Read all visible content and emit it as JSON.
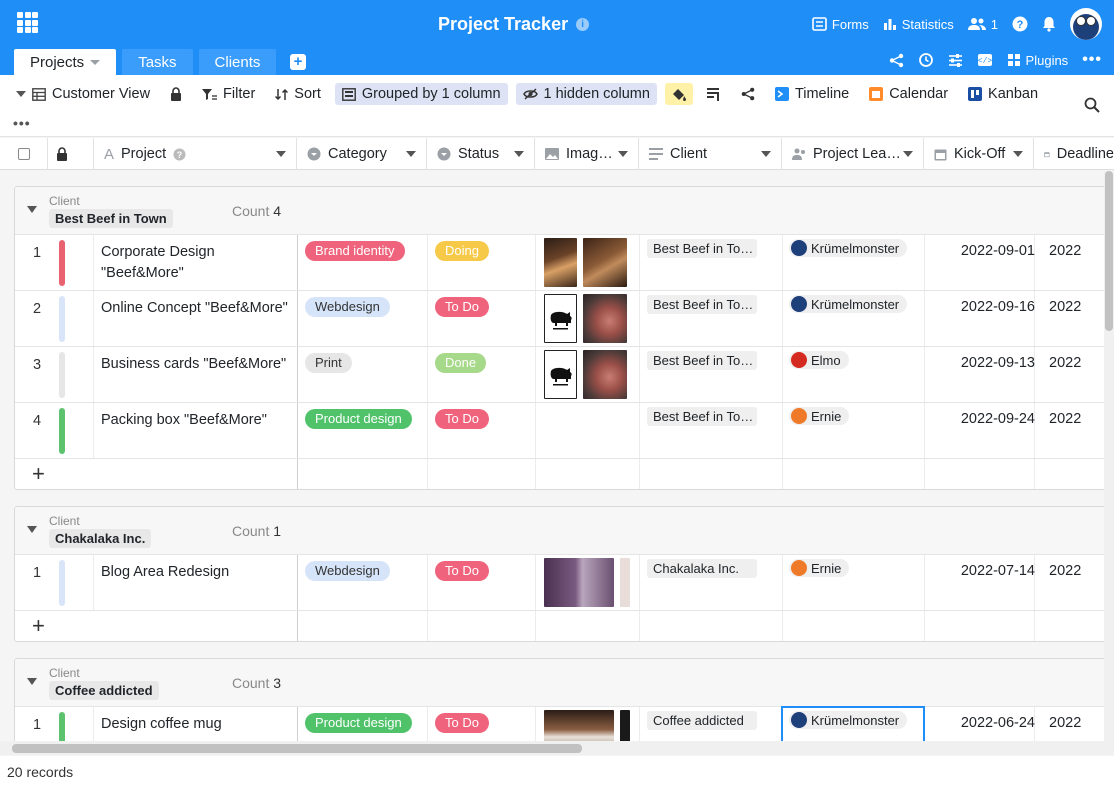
{
  "app": {
    "title": "Project Tracker",
    "info_icon": "info-icon"
  },
  "top_actions": {
    "forms": "Forms",
    "statistics": "Statistics",
    "collaborators": "1"
  },
  "tabs": [
    {
      "label": "Projects",
      "active": true
    },
    {
      "label": "Tasks"
    },
    {
      "label": "Clients"
    }
  ],
  "tab_actions": {
    "plugins": "Plugins"
  },
  "toolbar": {
    "view": "Customer View",
    "filter": "Filter",
    "sort": "Sort",
    "grouped": "Grouped by 1 column",
    "hidden": "1 hidden column",
    "timeline": "Timeline",
    "calendar": "Calendar",
    "kanban": "Kanban"
  },
  "columns": [
    "Project",
    "Category",
    "Status",
    "Imag…",
    "Client",
    "Project Lea…",
    "Kick-Off",
    "Deadline"
  ],
  "groups": [
    {
      "label": "Client",
      "value": "Best Beef in Town",
      "count_label": "Count",
      "count": "4",
      "rows": [
        {
          "num": "1",
          "color": "#e8636f",
          "project": "Corporate Design \"Beef&More\"",
          "category": "Brand identity",
          "category_color": "#f0637d",
          "status": "Doing",
          "status_color": "#f7c948",
          "client": "Best Beef in To…",
          "lead": "Krümelmonster",
          "kickoff": "2022-09-01",
          "deadline": "2022"
        },
        {
          "num": "2",
          "color": "#d8e4f8",
          "project": "Online Concept \"Beef&More\"",
          "category": "Webdesign",
          "category_color": "#d6e4fa",
          "status": "To Do",
          "status_color": "#f0637d",
          "client": "Best Beef in To…",
          "lead": "Krümelmonster",
          "kickoff": "2022-09-16",
          "deadline": "2022"
        },
        {
          "num": "3",
          "color": "#e6e6e6",
          "project": "Business cards \"Beef&More\"",
          "category": "Print",
          "category_color": "#e6e6e6",
          "status": "Done",
          "status_color": "#a7d98a",
          "client": "Best Beef in To…",
          "lead": "Elmo",
          "kickoff": "2022-09-13",
          "deadline": "2022"
        },
        {
          "num": "4",
          "color": "#5cc26d",
          "project": "Packing box \"Beef&More\"",
          "category": "Product design",
          "category_color": "#4fc26a",
          "status": "To Do",
          "status_color": "#f0637d",
          "client": "Best Beef in To…",
          "lead": "Ernie",
          "kickoff": "2022-09-24",
          "deadline": "2022"
        }
      ]
    },
    {
      "label": "Client",
      "value": "Chakalaka Inc.",
      "count_label": "Count",
      "count": "1",
      "rows": [
        {
          "num": "1",
          "color": "#d8e4f8",
          "project": "Blog Area Redesign",
          "category": "Webdesign",
          "category_color": "#d6e4fa",
          "status": "To Do",
          "status_color": "#f0637d",
          "client": "Chakalaka Inc.",
          "lead": "Ernie",
          "kickoff": "2022-07-14",
          "deadline": "2022"
        }
      ]
    },
    {
      "label": "Client",
      "value": "Coffee addicted",
      "count_label": "Count",
      "count": "3",
      "rows": [
        {
          "num": "1",
          "color": "#5cc26d",
          "project": "Design coffee mug",
          "category": "Product design",
          "category_color": "#4fc26a",
          "status": "To Do",
          "status_color": "#f0637d",
          "client": "Coffee addicted",
          "lead": "Krümelmonster",
          "kickoff": "2022-06-24",
          "deadline": "2022"
        }
      ]
    }
  ],
  "status_bar": {
    "records": "20 records"
  }
}
